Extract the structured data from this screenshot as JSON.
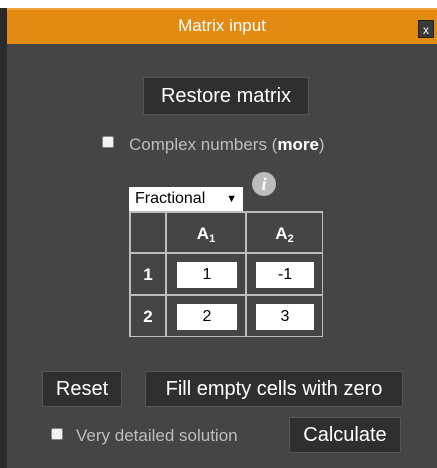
{
  "dialog": {
    "title": "Matrix input",
    "close_label": "x"
  },
  "buttons": {
    "restore": "Restore matrix",
    "reset": "Reset",
    "fill_zero": "Fill empty cells with zero",
    "calculate": "Calculate"
  },
  "options": {
    "complex_label": "Complex numbers (",
    "complex_more": "more",
    "complex_close": ")",
    "complex_checked": false,
    "detailed_label": "Very detailed solution",
    "detailed_checked": false
  },
  "format_select": {
    "selected": "Fractional",
    "arrow": "▼"
  },
  "info_icon": "i",
  "matrix": {
    "columns": [
      {
        "name": "A",
        "sub": "1"
      },
      {
        "name": "A",
        "sub": "2"
      }
    ],
    "rows": [
      "1",
      "2"
    ],
    "values": [
      [
        "1",
        "-1"
      ],
      [
        "2",
        "3"
      ]
    ]
  },
  "colors": {
    "title_bar": "#e28a12",
    "panel": "#454545",
    "button": "#2f2f2f"
  }
}
